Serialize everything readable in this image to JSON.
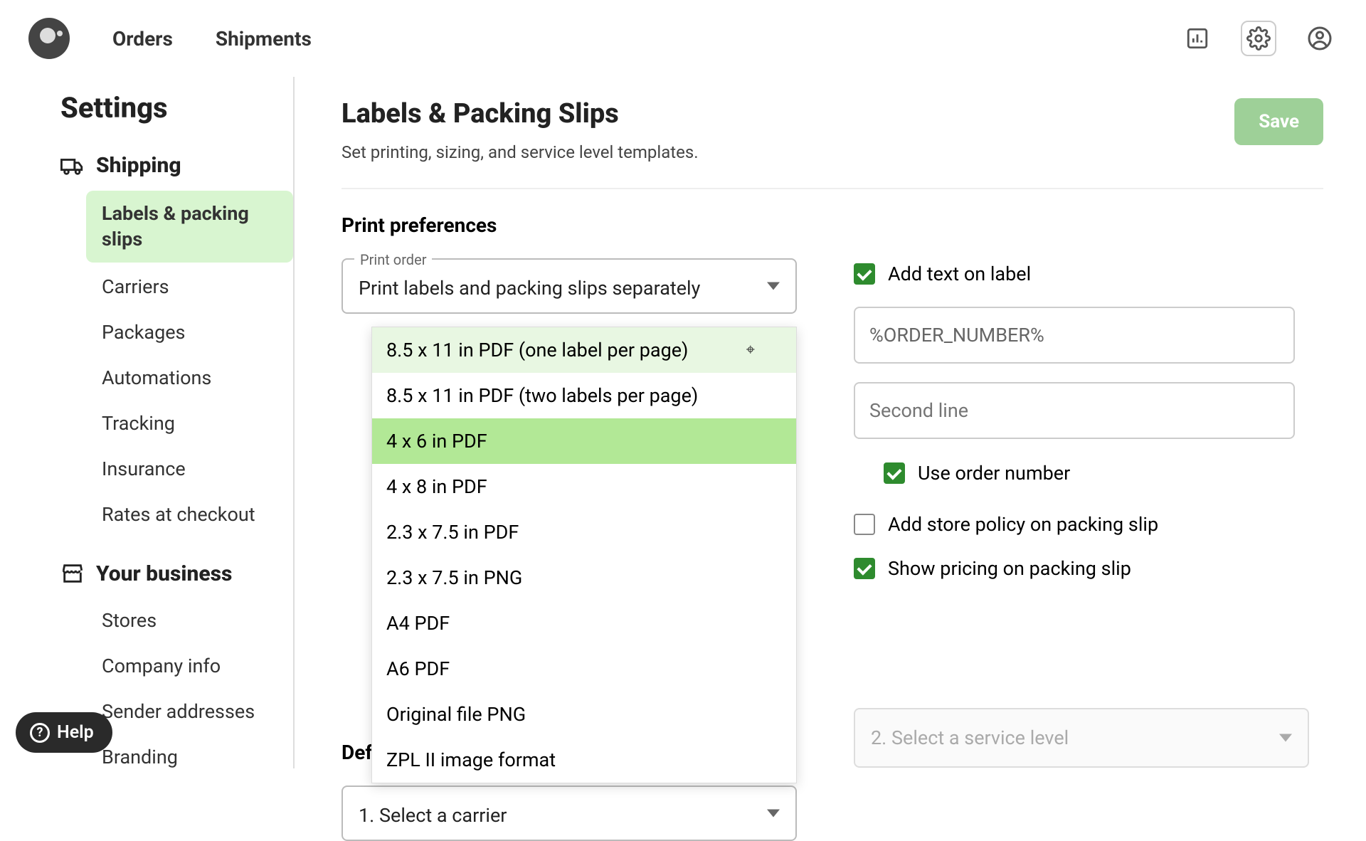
{
  "nav": {
    "orders": "Orders",
    "shipments": "Shipments"
  },
  "sidebar": {
    "title": "Settings",
    "group1": {
      "label": "Shipping",
      "items": [
        "Labels & packing slips",
        "Carriers",
        "Packages",
        "Automations",
        "Tracking",
        "Insurance",
        "Rates at checkout"
      ]
    },
    "group2": {
      "label": "Your business",
      "items": [
        "Stores",
        "Company info",
        "Sender addresses",
        "Branding"
      ]
    }
  },
  "page": {
    "title": "Labels & Packing Slips",
    "subtitle": "Set printing, sizing, and service level templates.",
    "save": "Save"
  },
  "prefs": {
    "heading": "Print preferences",
    "print_order_label": "Print order",
    "print_order_value": "Print labels and packing slips separately",
    "format_options": [
      "8.5 x 11 in PDF (one label per page)",
      "8.5 x 11 in PDF (two labels per page)",
      "4 x 6 in PDF",
      "4 x 8 in PDF",
      "2.3 x 7.5 in PDF",
      "2.3 x 7.5 in PNG",
      "A4 PDF",
      "A6 PDF",
      "Original file PNG",
      "ZPL II image format"
    ],
    "add_text_label": "Add text on label",
    "input1_value": "%ORDER_NUMBER%",
    "input2_placeholder": "Second line",
    "use_order_number": "Use order number",
    "store_policy": "Add store policy on packing slip",
    "show_pricing": "Show pricing on packing slip"
  },
  "carrier": {
    "heading": "Def",
    "step1": "1. Select a carrier",
    "step2": "2. Select a service level"
  },
  "help": "Help"
}
